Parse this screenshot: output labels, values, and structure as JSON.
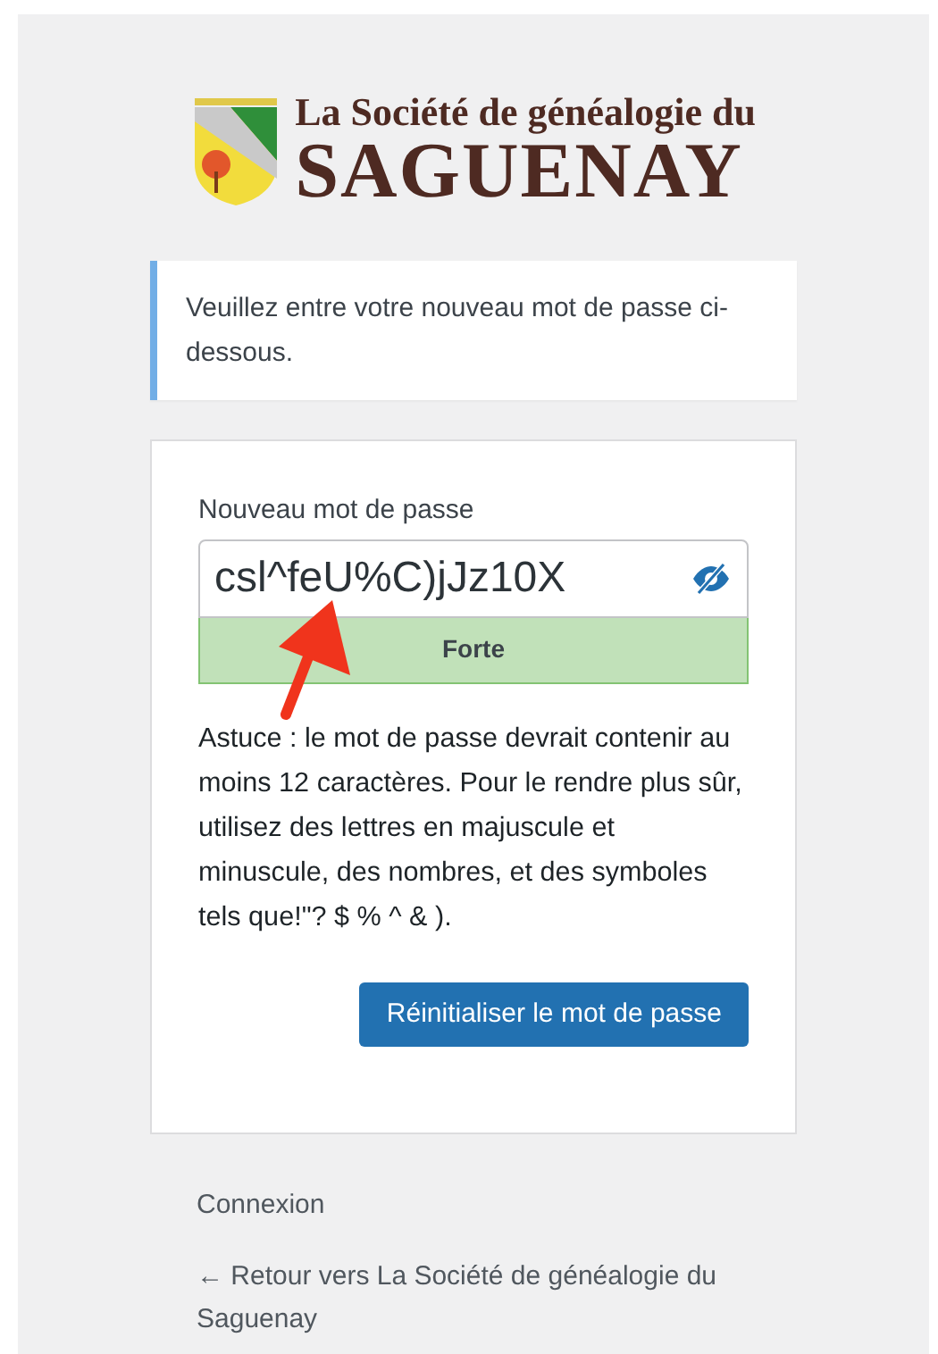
{
  "logo": {
    "line_1": "La Société de généalogie du",
    "line_2": "SAGUENAY"
  },
  "message": "Veuillez entre votre nouveau mot de passe ci-dessous.",
  "form": {
    "label": "Nouveau mot de passe",
    "value": "csl^feU%C)jJz10X",
    "password_visible": true,
    "strength": {
      "label": "Forte",
      "kind": "strong"
    },
    "hint": "Astuce : le mot de passe devrait contenir au moins 12 caractères. Pour le rendre plus sûr, utilisez des lettres en majuscule et minuscule, des nombres, et des symboles tels que!\"? $ % ^ & ).",
    "button": "Réinitialiser le mot de passe"
  },
  "links": [
    "Connexion",
    "← Retour vers La Société de généalogie du Saguenay"
  ],
  "annotation": {
    "kind": "arrow"
  }
}
